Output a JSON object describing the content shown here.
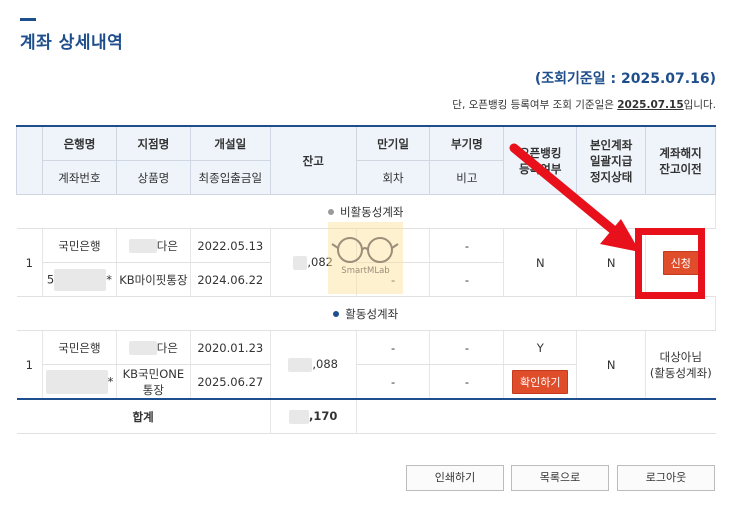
{
  "page": {
    "title": "계좌 상세내역",
    "date_basis": "(조회기준일 : 2025.07.16)",
    "ob_notice_prefix": "단, 오픈뱅킹 등록여부 조회 기준일은 ",
    "ob_notice_date": "2025.07.15",
    "ob_notice_suffix": "입니다."
  },
  "headers": {
    "bank": "은행명",
    "account_no": "계좌번호",
    "branch": "지점명",
    "product": "상품명",
    "open_date": "개설일",
    "last_txn": "최종입출금일",
    "balance": "잔고",
    "maturity": "만기일",
    "round": "회차",
    "sub_name": "부기명",
    "remark": "비고",
    "ob_reg_1": "오픈뱅킹",
    "ob_reg_2": "등록여부",
    "auth_1": "본인계좌",
    "auth_2": "일괄지급",
    "auth_3": "정지상태",
    "close_1": "계좌해지",
    "close_2": "잔고이전"
  },
  "sections": {
    "inactive": "비활동성계좌",
    "active": "활동성계좌"
  },
  "inactive_row": {
    "no": "1",
    "bank": "국민은행",
    "account_no": "5",
    "account_star": "*",
    "branch": "다은",
    "product": "KB마이핏통장",
    "open_date": "2022.05.13",
    "last_txn": "2024.06.22",
    "balance": ",082",
    "maturity_dash": "-",
    "round_dash": "-",
    "subname_dash": "-",
    "remark_dash": "-",
    "ob": "N",
    "auth": "N",
    "apply_btn": "신청"
  },
  "active_row": {
    "no": "1",
    "bank": "국민은행",
    "account_star": "*",
    "branch": "다은",
    "product": "KB국민ONE 통장",
    "open_date": "2020.01.23",
    "last_txn": "2025.06.27",
    "balance": ",088",
    "maturity_dash": "-",
    "round_dash": "-",
    "subname_dash": "-",
    "remark_dash": "-",
    "ob": "Y",
    "confirm_btn": "확인하기",
    "auth": "N",
    "close_status_1": "대상아님",
    "close_status_2": "(활동성계좌)"
  },
  "total": {
    "label": "합계",
    "balance": ",170"
  },
  "buttons": {
    "print": "인쇄하기",
    "list": "목록으로",
    "logout": "로그아웃"
  },
  "watermark": "SmartMLab",
  "colors": {
    "brand": "#1f4e8c",
    "accent_red": "#e04d2a",
    "highlight": "#e8101b"
  }
}
